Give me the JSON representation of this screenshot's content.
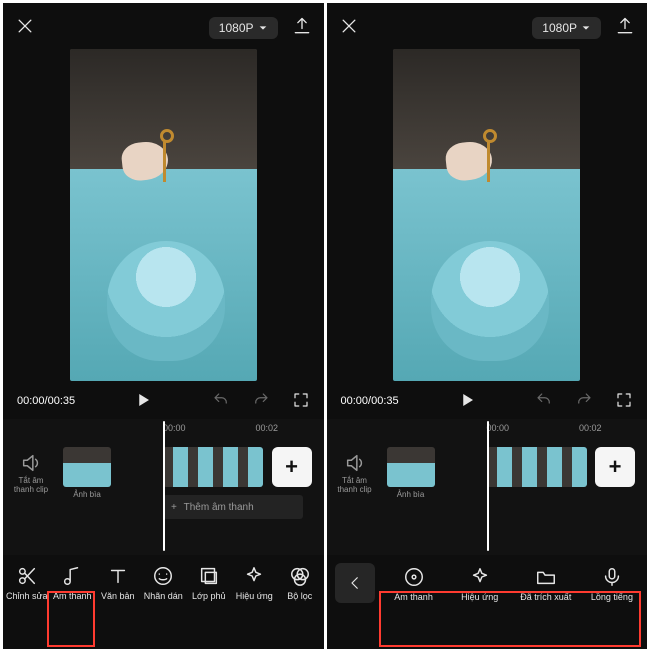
{
  "resolution": {
    "label": "1080P"
  },
  "time": {
    "current": "00:00",
    "duration": "00:35"
  },
  "ruler": {
    "t0": "00:00",
    "t1": "00:02"
  },
  "clip": {
    "mute_label": "Tắt âm thanh clip",
    "cover_label": "Ảnh bìa"
  },
  "addaudio": {
    "label": "Thêm âm thanh"
  },
  "left_tools": [
    {
      "name": "edit",
      "label": "Chỉnh sửa"
    },
    {
      "name": "audio",
      "label": "Âm thanh"
    },
    {
      "name": "text",
      "label": "Văn bản"
    },
    {
      "name": "sticker",
      "label": "Nhãn dán"
    },
    {
      "name": "overlay",
      "label": "Lớp phủ"
    },
    {
      "name": "effect",
      "label": "Hiệu ứng"
    },
    {
      "name": "filter",
      "label": "Bộ lọc"
    }
  ],
  "right_tools": [
    {
      "name": "audio",
      "label": "Âm thanh"
    },
    {
      "name": "effect",
      "label": "Hiệu ứng"
    },
    {
      "name": "extracted",
      "label": "Đã trích xuất"
    },
    {
      "name": "voice",
      "label": "Lồng tiếng"
    }
  ]
}
